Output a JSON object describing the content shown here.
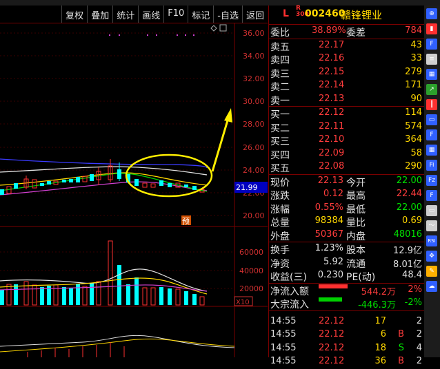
{
  "toolbar": {
    "items": [
      "复权",
      "叠加",
      "统计",
      "画线",
      "F10",
      "标记",
      "-自选",
      "返回"
    ]
  },
  "stock": {
    "flag": "L",
    "r_top": "R",
    "r_bot": "300",
    "code": "002460",
    "name": "赣锋锂业"
  },
  "price_axis": [
    "36.00",
    "34.00",
    "32.00",
    "30.00",
    "28.00",
    "26.00",
    "24.00",
    "22.00",
    "20.00"
  ],
  "current_price_label": "21.99",
  "pre_label": "预",
  "volume_axis": [
    "60000",
    "40000",
    "20000"
  ],
  "volume_unit": "X10",
  "weibi": {
    "label": "委比",
    "value": "38.89%",
    "label2": "委差",
    "value2": "784"
  },
  "asks": [
    {
      "label": "卖五",
      "price": "22.17",
      "vol": "43"
    },
    {
      "label": "卖四",
      "price": "22.16",
      "vol": "33"
    },
    {
      "label": "卖三",
      "price": "22.15",
      "vol": "279"
    },
    {
      "label": "卖二",
      "price": "22.14",
      "vol": "171"
    },
    {
      "label": "卖一",
      "price": "22.13",
      "vol": "90"
    }
  ],
  "bids": [
    {
      "label": "买一",
      "price": "22.12",
      "vol": "114"
    },
    {
      "label": "买二",
      "price": "22.11",
      "vol": "574"
    },
    {
      "label": "买三",
      "price": "22.10",
      "vol": "364"
    },
    {
      "label": "买四",
      "price": "22.09",
      "vol": "58"
    },
    {
      "label": "买五",
      "price": "22.08",
      "vol": "290"
    }
  ],
  "quote": [
    {
      "l1": "现价",
      "v1": "22.13",
      "l2": "今开",
      "v2": "22.00"
    },
    {
      "l1": "涨跌",
      "v1": "0.12",
      "l2": "最高",
      "v2": "22.44"
    },
    {
      "l1": "涨幅",
      "v1": "0.55%",
      "l2": "最低",
      "v2": "22.00"
    },
    {
      "l1": "总量",
      "v1": "98384",
      "l2": "量比",
      "v2": "0.69"
    },
    {
      "l1": "外盘",
      "v1": "50367",
      "l2": "内盘",
      "v2": "48016"
    }
  ],
  "stats": [
    {
      "l1": "换手",
      "v1": "1.23%",
      "l2": "股本",
      "v2": "12.9亿"
    },
    {
      "l1": "净资",
      "v1": "5.92",
      "l2": "流通",
      "v2": "8.01亿"
    },
    {
      "l1": "收益(三)",
      "v1": "0.230",
      "l2": "PE(动)",
      "v2": "48.4"
    }
  ],
  "flows": [
    {
      "label": "净流入额",
      "value": "544.2万",
      "pct": "2%",
      "color": "#ff3030"
    },
    {
      "label": "大宗流入",
      "value": "-446.3万",
      "pct": "-2%",
      "color": "#00d000"
    }
  ],
  "ticks": [
    {
      "time": "14:55",
      "price": "22.12",
      "vol": "17",
      "flag": "",
      "n": "2"
    },
    {
      "time": "14:55",
      "price": "22.12",
      "vol": "6",
      "flag": "B",
      "n": "2"
    },
    {
      "time": "14:55",
      "price": "22.12",
      "vol": "18",
      "flag": "S",
      "n": "4"
    },
    {
      "time": "14:55",
      "price": "22.12",
      "vol": "36",
      "flag": "B",
      "n": "2"
    }
  ],
  "sidebar_icons": [
    {
      "name": "minute-chart-icon",
      "color": "#3060ff",
      "glyph": "⊕"
    },
    {
      "name": "kline-icon",
      "color": "#ff3030",
      "glyph": "▮"
    },
    {
      "name": "f10-icon",
      "color": "#3060ff",
      "glyph": "F"
    },
    {
      "name": "list-icon",
      "color": "#cfcfcf",
      "glyph": "≡"
    },
    {
      "name": "table-icon",
      "color": "#3060ff",
      "glyph": "▦"
    },
    {
      "name": "trend-icon",
      "color": "#2ca02c",
      "glyph": "↗"
    },
    {
      "name": "candle-icon",
      "color": "#ff3030",
      "glyph": "║"
    },
    {
      "name": "window-icon",
      "color": "#3060ff",
      "glyph": "▭"
    },
    {
      "name": "fund-icon",
      "color": "#3060ff",
      "glyph": "F"
    },
    {
      "name": "grid-icon",
      "color": "#3060ff",
      "glyph": "▦"
    },
    {
      "name": "fin-icon",
      "color": "#3060ff",
      "glyph": "Fi"
    },
    {
      "name": "fiz-icon",
      "color": "#3060ff",
      "glyph": "Fz"
    },
    {
      "name": "pin-icon",
      "color": "#3060ff",
      "glyph": "F"
    },
    {
      "name": "panel-icon",
      "color": "#cfcfcf",
      "glyph": "▭"
    },
    {
      "name": "macd-icon",
      "color": "#cfcfcf",
      "glyph": "〜"
    },
    {
      "name": "rsi-icon",
      "color": "#3060ff",
      "glyph": "RSI"
    },
    {
      "name": "move-icon",
      "color": "#3060ff",
      "glyph": "✥"
    },
    {
      "name": "pen-icon",
      "color": "#ffb000",
      "glyph": "✎"
    },
    {
      "name": "cloud-icon",
      "color": "#3060ff",
      "glyph": "☁"
    }
  ]
}
